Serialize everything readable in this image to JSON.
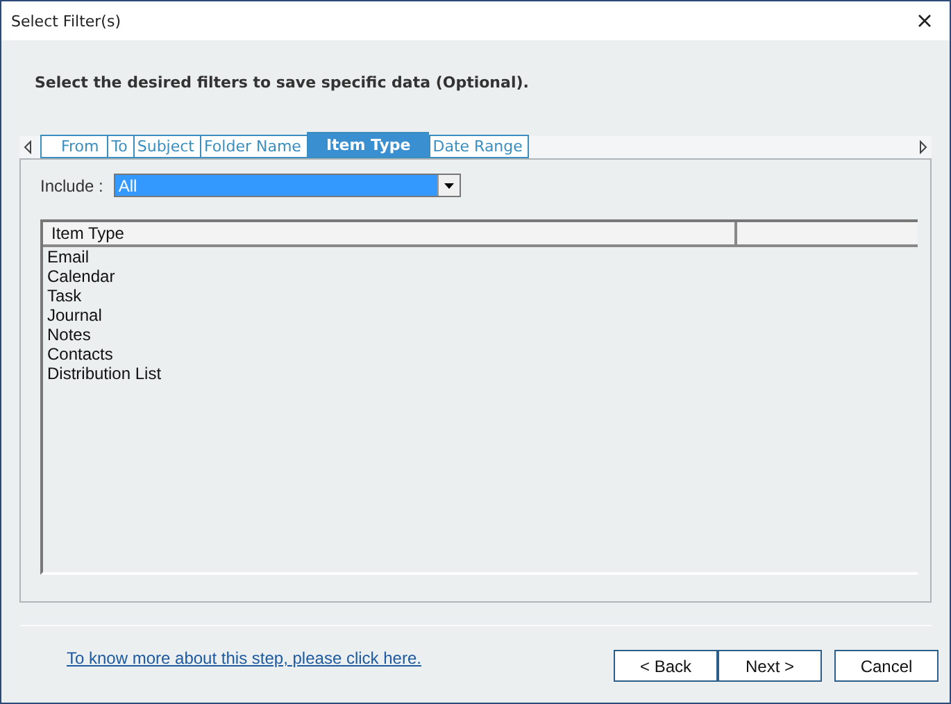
{
  "window": {
    "title": "Select Filter(s)"
  },
  "instruction": "Select the desired filters to save specific data (Optional).",
  "tabs": [
    {
      "label": "From",
      "selected": false
    },
    {
      "label": "To",
      "selected": false
    },
    {
      "label": "Subject",
      "selected": false
    },
    {
      "label": "Folder Name",
      "selected": false
    },
    {
      "label": "Item Type",
      "selected": true
    },
    {
      "label": "Date Range",
      "selected": false
    }
  ],
  "include": {
    "label": "Include :",
    "value": "All"
  },
  "table": {
    "columns": [
      "Item Type"
    ],
    "rows": [
      "Email",
      "Calendar",
      "Task",
      "Journal",
      "Notes",
      "Contacts",
      "Distribution List"
    ]
  },
  "help_link": "To know more about this step, please click here.",
  "buttons": [
    "< Back",
    "Next >",
    "Cancel"
  ]
}
